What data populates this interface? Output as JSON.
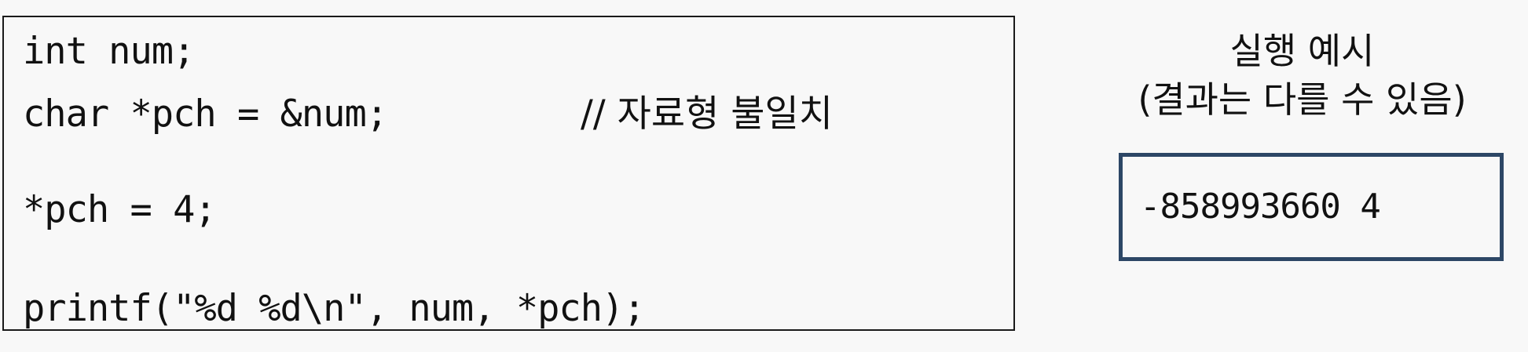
{
  "code": {
    "lines": [
      "int num;",
      "char *pch = &num;",
      "*pch = 4;",
      "printf(\"%d %d\\n\", num, *pch);"
    ],
    "comment": "// 자료형 불일치"
  },
  "example": {
    "title": "실행 예시",
    "subtitle": "(결과는 다를 수 있음)",
    "output": "-858993660 4"
  },
  "colors": {
    "background": "#f8f8f8",
    "code_border": "#1a1a1a",
    "output_border": "#2d4766"
  }
}
